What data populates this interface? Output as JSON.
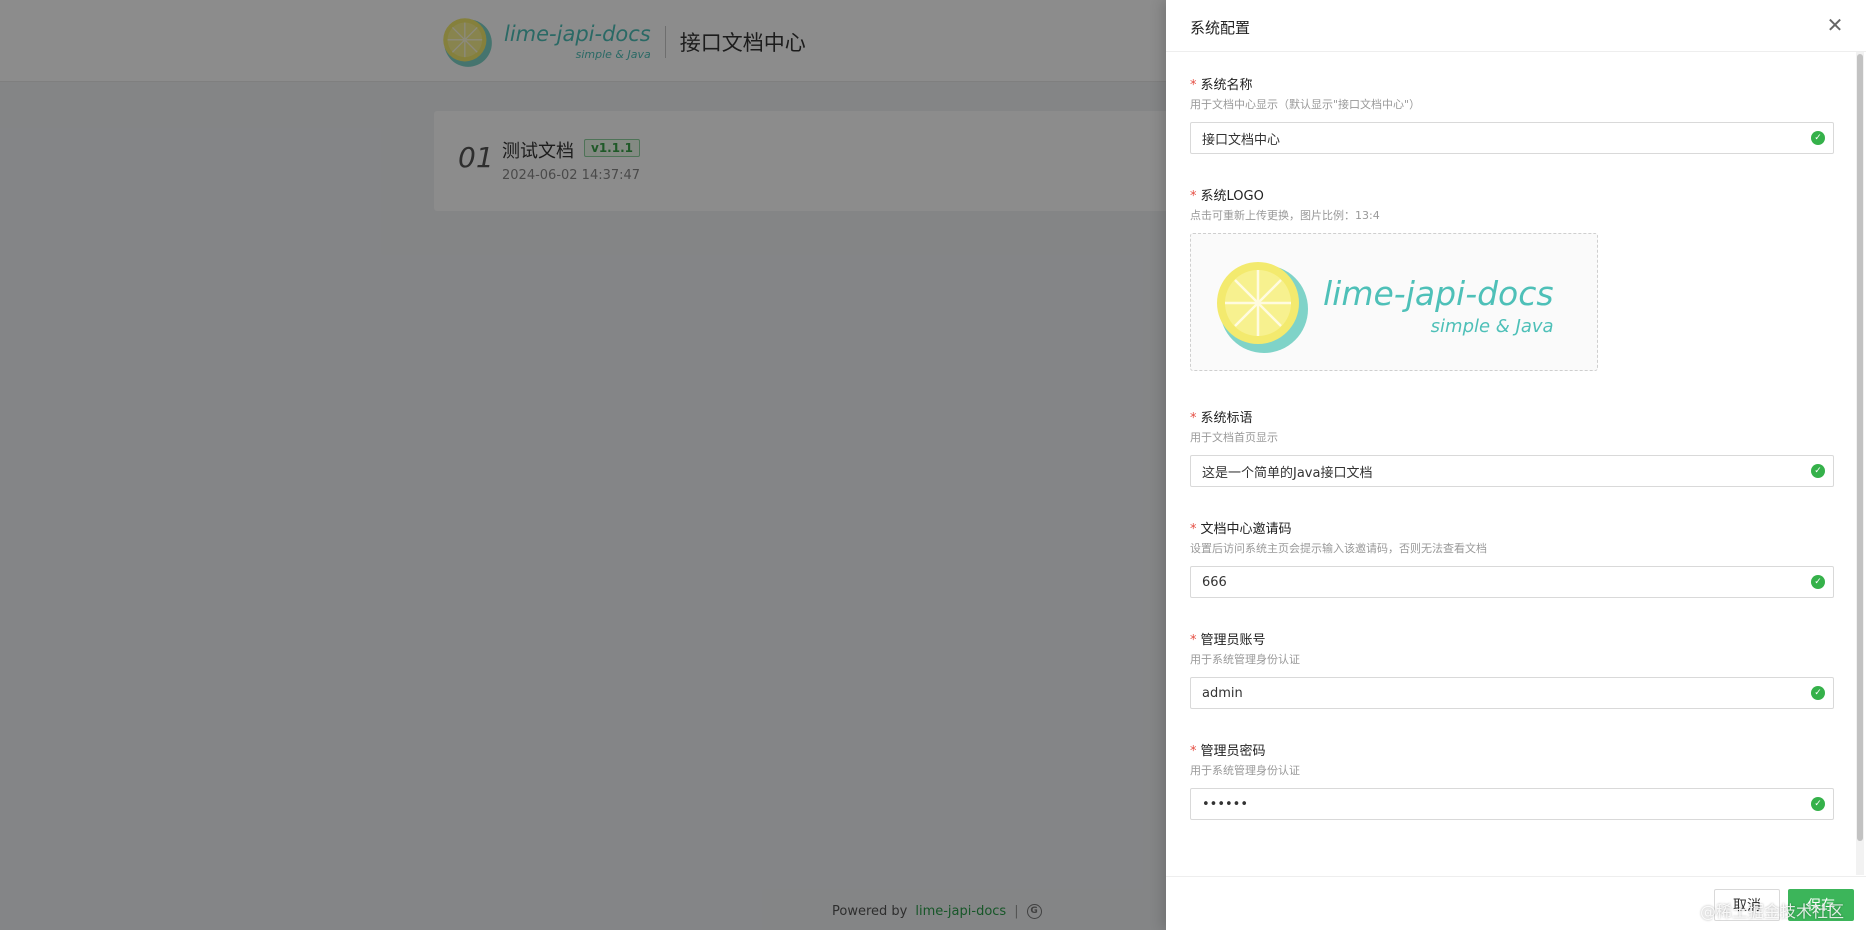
{
  "header": {
    "logo_name": "lime-japi-docs",
    "logo_sub": "simple & Java",
    "title": "接口文档中心"
  },
  "doc_list": [
    {
      "index": "01",
      "name": "测试文档",
      "version": "v1.1.1",
      "time": "2024-06-02 14:37:47"
    }
  ],
  "footer": {
    "powered_by": "Powered by",
    "link": "lime-japi-docs",
    "separator": "|"
  },
  "drawer": {
    "title": "系统配置",
    "fields": {
      "system_name": {
        "label": "系统名称",
        "hint": "用于文档中心显示（默认显示\"接口文档中心\"）",
        "value": "接口文档中心"
      },
      "system_logo": {
        "label": "系统LOGO",
        "hint": "点击可重新上传更换，图片比例：13:4",
        "logo_name": "lime-japi-docs",
        "logo_sub": "simple & Java"
      },
      "system_slogan": {
        "label": "系统标语",
        "hint": "用于文档首页显示",
        "value": "这是一个简单的Java接口文档"
      },
      "invite_code": {
        "label": "文档中心邀请码",
        "hint": "设置后访问系统主页会提示输入该邀请码，否则无法查看文档",
        "value": "666"
      },
      "admin_account": {
        "label": "管理员账号",
        "hint": "用于系统管理身份认证",
        "value": "admin"
      },
      "admin_password": {
        "label": "管理员密码",
        "hint": "用于系统管理身份认证",
        "value": "••••••"
      }
    },
    "buttons": {
      "cancel": "取消",
      "save": "保存"
    }
  },
  "watermark": "@稀土掘金技术社区",
  "colors": {
    "brand": "#4ec0b8",
    "primary": "#3cb55a",
    "required": "#e54d42",
    "valid": "#35b14a"
  },
  "icons": {
    "close": "close-icon",
    "valid": "check-circle-icon",
    "logo": "lemon-logo-icon"
  }
}
